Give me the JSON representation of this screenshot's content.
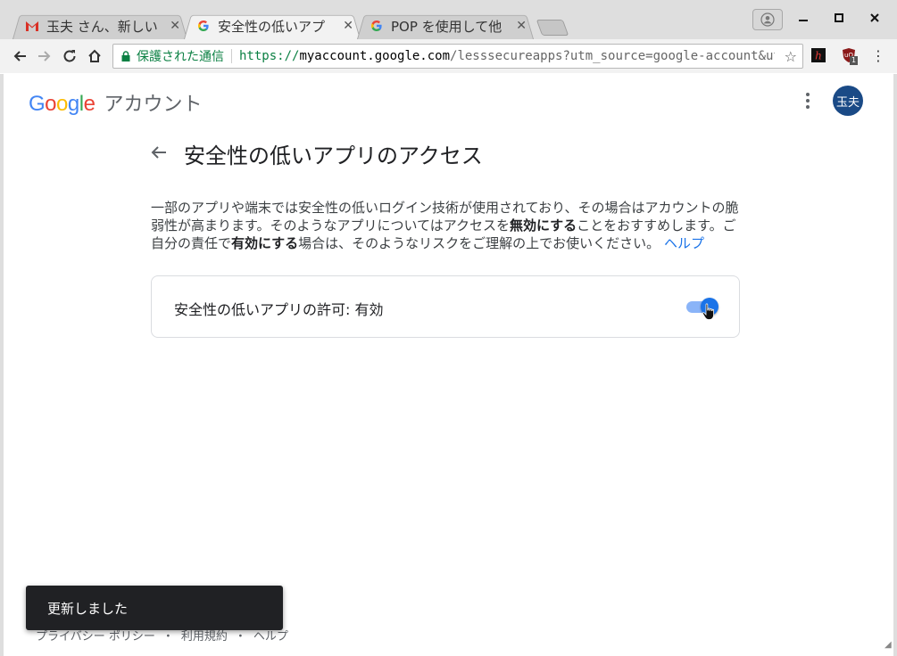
{
  "browser": {
    "tabs": [
      {
        "title": "玉夫 さん、新しい",
        "favicon": "gmail-icon",
        "active": false
      },
      {
        "title": "安全性の低いアプ",
        "favicon": "google-icon",
        "active": true
      },
      {
        "title": "POP を使用して他",
        "favicon": "google-icon",
        "active": false
      }
    ],
    "omnibox": {
      "secure_label": "保護された通信",
      "url_scheme": "https://",
      "url_host": "myaccount.google.com",
      "url_path": "/lesssecureapps?utm_source=google-account&utm_…"
    },
    "extensions": [
      {
        "icon": "h-extension-icon",
        "badge": ""
      },
      {
        "icon": "ublock-icon",
        "badge": "1"
      }
    ]
  },
  "header": {
    "logo_text": "Google",
    "product": "アカウント",
    "avatar_initials": "玉夫"
  },
  "main": {
    "title": "安全性の低いアプリのアクセス",
    "description": {
      "part1": "一部のアプリや端末では安全性の低いログイン技術が使用されており、その場合はアカウントの脆弱性が高まります。そのようなアプリについてはアクセスを",
      "bold1": "無効にする",
      "part2": "ことをおすすめします。ご自分の責任で",
      "bold2": "有効にする",
      "part3": "場合は、そのようなリスクをご理解の上でお使いください。",
      "help_link": "ヘルプ"
    },
    "setting": {
      "label": "安全性の低いアプリの許可: 有効",
      "enabled": true
    }
  },
  "footer": {
    "links": [
      "プライバシー ポリシー",
      "・",
      "利用規約",
      "・",
      "ヘルプ"
    ]
  },
  "snackbar": {
    "message": "更新しました"
  },
  "colors": {
    "accent": "#1a73e8",
    "secure": "#0b8043",
    "snackbar_bg": "#202124"
  }
}
